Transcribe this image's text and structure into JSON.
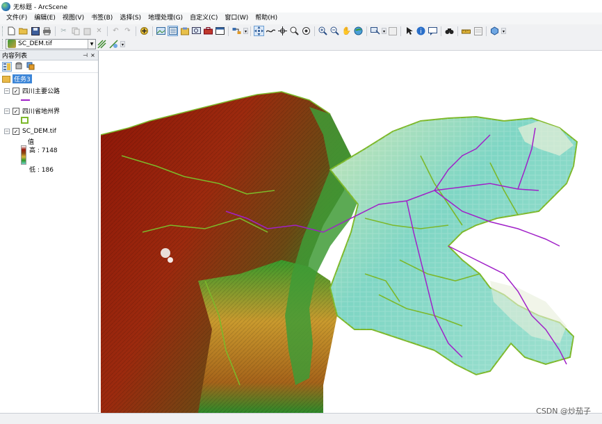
{
  "window": {
    "title": "无标题 - ArcScene",
    "app_icon": "arcscene-globe-icon"
  },
  "menu": {
    "items": [
      "文件(F)",
      "编辑(E)",
      "视图(V)",
      "书签(B)",
      "选择(S)",
      "地理处理(G)",
      "自定义(C)",
      "窗口(W)",
      "帮助(H)"
    ]
  },
  "toolbar": {
    "layer_selector": {
      "value": "SC_DEM.tif"
    }
  },
  "toc": {
    "title": "内容列表",
    "pin_glyph": "📌",
    "close_glyph": "×",
    "scene_name": "任务3",
    "layers": [
      {
        "name": "四川主要公路",
        "checked": true,
        "symbol": "line",
        "color": "#a020c8"
      },
      {
        "name": "四川省地州界",
        "checked": true,
        "symbol": "polygon",
        "color": "#7cb82a"
      },
      {
        "name": "SC_DEM.tif",
        "checked": true,
        "symbol": "ramp",
        "field_label": "值",
        "high_label": "高 : 7148",
        "low_label": "低 : 186"
      }
    ]
  },
  "colors": {
    "highlight": "#3d86d8",
    "road": "#a020c8",
    "boundary": "#7cb82a",
    "basin": "#7fd6c4",
    "plateau_red": "#9c1a0c"
  },
  "watermark": "CSDN @炒茄子"
}
